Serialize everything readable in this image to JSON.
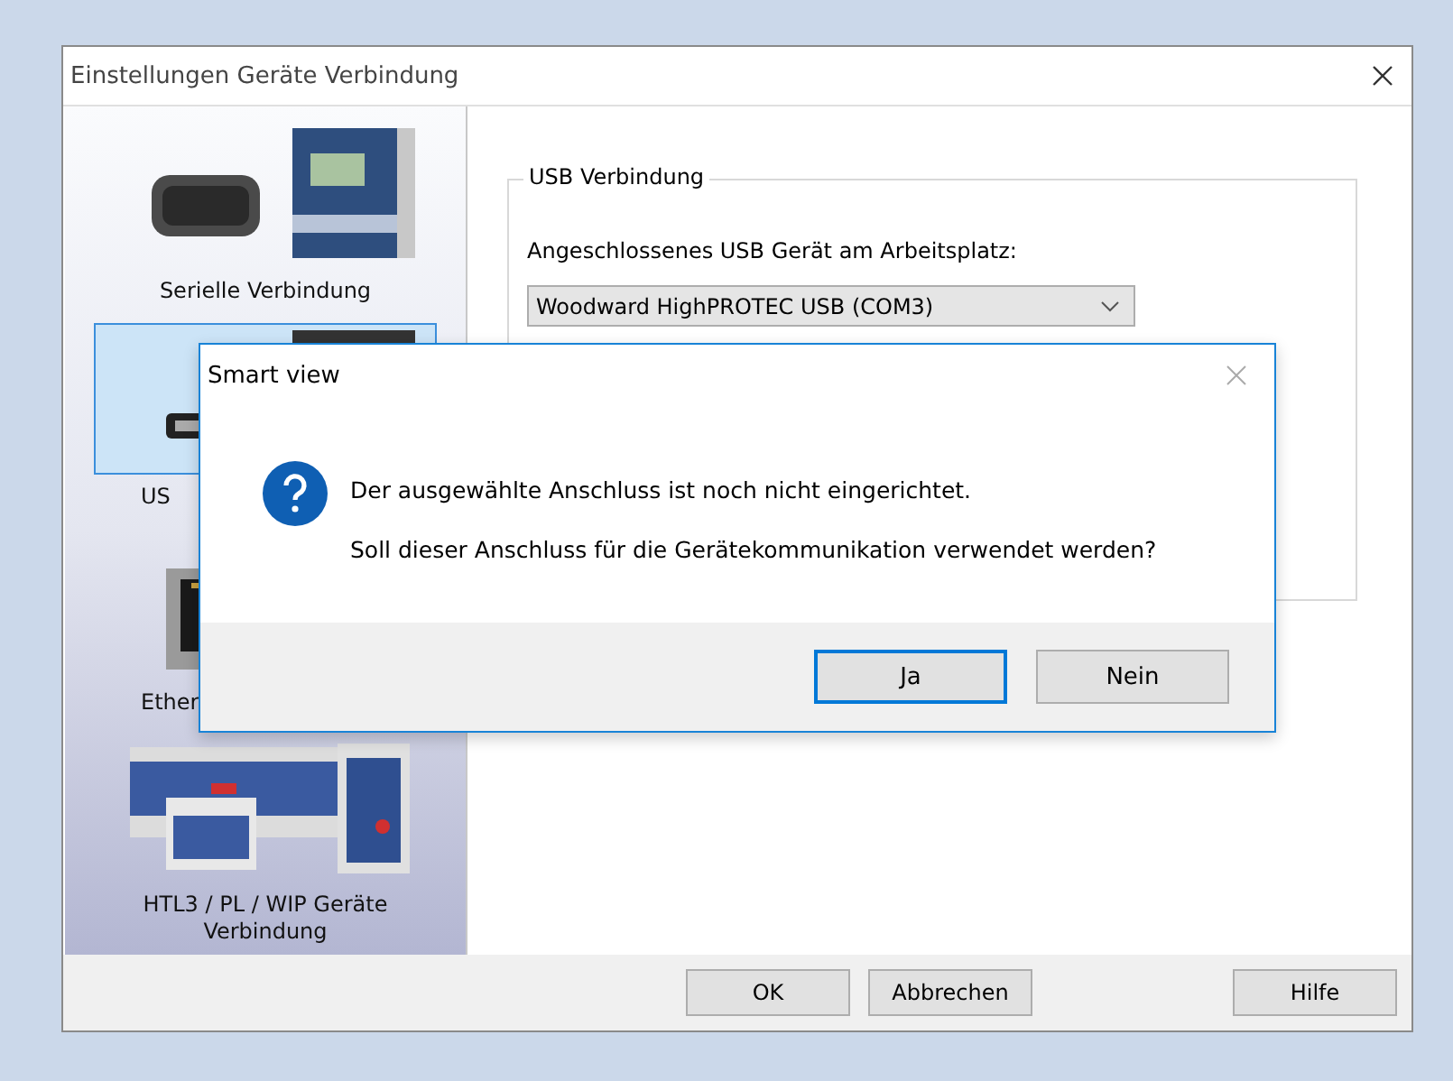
{
  "window": {
    "title": "Einstellungen Geräte Verbindung"
  },
  "sidebar": {
    "items": [
      {
        "label": "Serielle Verbindung",
        "selected": false
      },
      {
        "label": "US",
        "selected": true
      },
      {
        "label": "Ether",
        "selected": false
      },
      {
        "label": "HTL3 / PL / WIP Geräte Verbindung",
        "selected": false
      }
    ]
  },
  "group": {
    "title": "USB Verbindung",
    "field_label": "Angeschlossenes USB Gerät am Arbeitsplatz:",
    "dropdown": {
      "value": "Woodward HighPROTEC USB (COM3)"
    }
  },
  "buttons": [
    {
      "label": "OK"
    },
    {
      "label": "Abbrechen"
    },
    {
      "label": "Hilfe"
    }
  ],
  "dialog": {
    "title": "Smart view",
    "lines": [
      "Der ausgewählte Anschluss ist noch nicht eingerichtet.",
      "Soll dieser Anschluss für die Gerätekommunikation verwendet werden?"
    ],
    "buttons": [
      {
        "label": "Ja",
        "default": true
      },
      {
        "label": "Nein",
        "default": false
      }
    ]
  }
}
